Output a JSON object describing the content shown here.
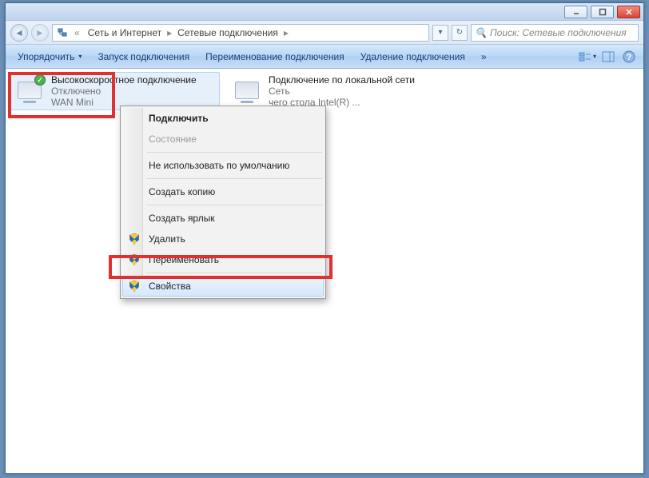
{
  "breadcrumb": {
    "level1": "Сеть и Интернет",
    "level2": "Сетевые подключения"
  },
  "search": {
    "placeholder": "Поиск: Сетевые подключения"
  },
  "toolbar": {
    "organize": "Упорядочить",
    "start": "Запуск подключения",
    "rename": "Переименование подключения",
    "delete": "Удаление подключения"
  },
  "connections": [
    {
      "title": "Высокоскоростное подключение",
      "status": "Отключено",
      "device": "WAN Mini"
    },
    {
      "title": "Подключение по локальной сети",
      "status": "Сеть",
      "device_tail": "чего стола Intel(R) ..."
    }
  ],
  "context_menu": {
    "connect": "Подключить",
    "status": "Состояние",
    "not_default": "Не использовать по умолчанию",
    "copy": "Создать копию",
    "shortcut": "Создать ярлык",
    "delete": "Удалить",
    "rename": "Переименовать",
    "properties": "Свойства"
  }
}
